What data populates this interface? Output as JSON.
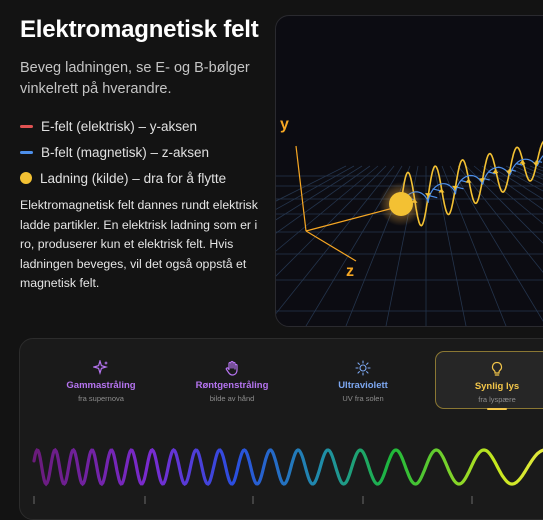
{
  "title": "Elektromagnetisk felt",
  "subtitle": "Beveg ladningen, se E- og B-bølger vinkelrett på hverandre.",
  "legend": [
    {
      "label": "E-felt (elektrisk) – y-aksen",
      "color": "#e05252",
      "kind": "line"
    },
    {
      "label": "B-felt (magnetisk) – z-aksen",
      "color": "#4d8fea",
      "kind": "line"
    },
    {
      "label": "Ladning (kilde) – dra for å flytte",
      "color": "#f3c133",
      "kind": "dot"
    }
  ],
  "description": "Elektromagnetisk felt dannes rundt elektrisk ladde partikler. En elektrisk ladning som er i ro, produserer kun et elektrisk felt. Hvis ladningen beveges, vil det også oppstå et magnetisk felt.",
  "viz": {
    "axis_y": "y",
    "axis_z": "z",
    "axis_color": "#f5a623",
    "wave_color": "#f3c133",
    "b_color": "#4d8fea"
  },
  "spectrum": {
    "cards": [
      {
        "label": "Gammastråling",
        "sub": "fra supernova",
        "icon": "sparkles-icon",
        "color": "#b574f0",
        "active": false
      },
      {
        "label": "Røntgenstråling",
        "sub": "bilde av hånd",
        "icon": "hand-icon",
        "color": "#b574f0",
        "active": false
      },
      {
        "label": "Ultraviolett",
        "sub": "UV fra solen",
        "icon": "sun-icon",
        "color": "#7da8f2",
        "active": false
      },
      {
        "label": "Synlig lys",
        "sub": "fra lyspære",
        "icon": "lightbulb-icon",
        "color": "#f3c64a",
        "active": true
      }
    ]
  }
}
